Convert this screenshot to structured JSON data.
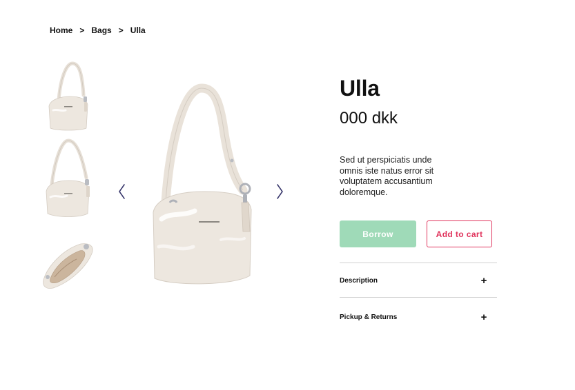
{
  "breadcrumb": {
    "home": "Home",
    "separator": ">",
    "category": "Bags",
    "current": "Ulla"
  },
  "gallery": {
    "thumbnails": [
      {
        "alt": "Ulla bag front view"
      },
      {
        "alt": "Ulla bag side view"
      },
      {
        "alt": "Ulla bag interior view"
      }
    ],
    "prev_icon": "chevron-left-icon",
    "next_icon": "chevron-right-icon"
  },
  "product": {
    "name": "Ulla",
    "price": "000 dkk",
    "description": "Sed ut perspiciatis unde omnis iste natus error sit voluptatem accusantium doloremque."
  },
  "actions": {
    "borrow_label": "Borrow",
    "cart_label": "Add to cart"
  },
  "accordion": {
    "description_label": "Description",
    "pickup_label": "Pickup & Returns",
    "expand_icon": "plus-icon"
  },
  "colors": {
    "borrow_bg": "#9fdab8",
    "accent": "#e0335c",
    "bag": "#ede7df",
    "arrow": "#3b3a6e"
  }
}
